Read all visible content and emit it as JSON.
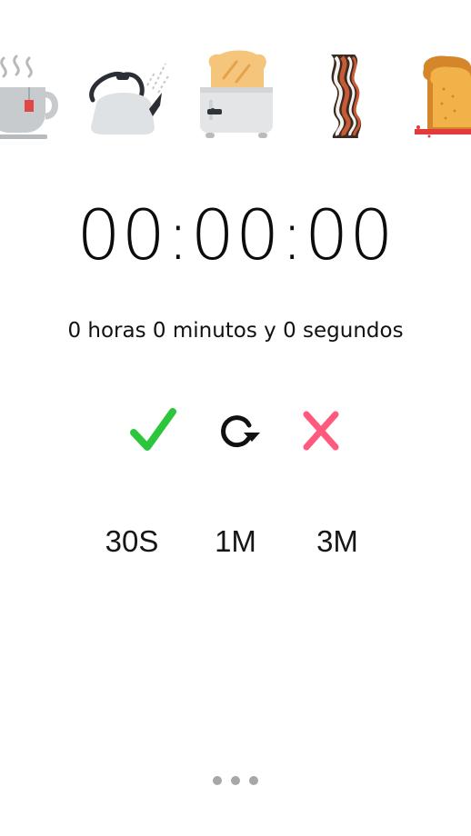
{
  "icons": {
    "items": [
      {
        "name": "tea-cup-icon",
        "colors": {
          "body": "#c8cbce",
          "steam": "#b7b9bb",
          "tag": "#e04848"
        }
      },
      {
        "name": "kettle-icon",
        "colors": {
          "body": "#dfe2e4",
          "handle": "#2b2f35",
          "steam": "#c8c8c8"
        }
      },
      {
        "name": "toaster-icon",
        "colors": {
          "body": "#e3e5e6",
          "bread": "#f4c57a",
          "lever": "#2f333a"
        }
      },
      {
        "name": "bacon-icon",
        "colors": {
          "outline": "#3a2a22",
          "fat": "#f5f2ee",
          "meat": "#c85a38"
        }
      },
      {
        "name": "toast-slice-icon",
        "colors": {
          "crust": "#d6862a",
          "crumb": "#f2b24a",
          "jam": "#e33b3b"
        }
      }
    ]
  },
  "timer": {
    "display": "00:00:00",
    "words": "0 horas 0 minutos y 0 segundos"
  },
  "controls": {
    "start": {
      "icon": "checkmark-icon",
      "color": "#2bc63b"
    },
    "reset": {
      "icon": "refresh-icon",
      "color": "#111111"
    },
    "cancel": {
      "icon": "close-icon",
      "color": "#ff5a7e"
    }
  },
  "presets": [
    {
      "label": "30S"
    },
    {
      "label": "1M"
    },
    {
      "label": "3M"
    }
  ],
  "pager": {
    "count": 3,
    "active": 1,
    "color": "#a7a7a7"
  }
}
